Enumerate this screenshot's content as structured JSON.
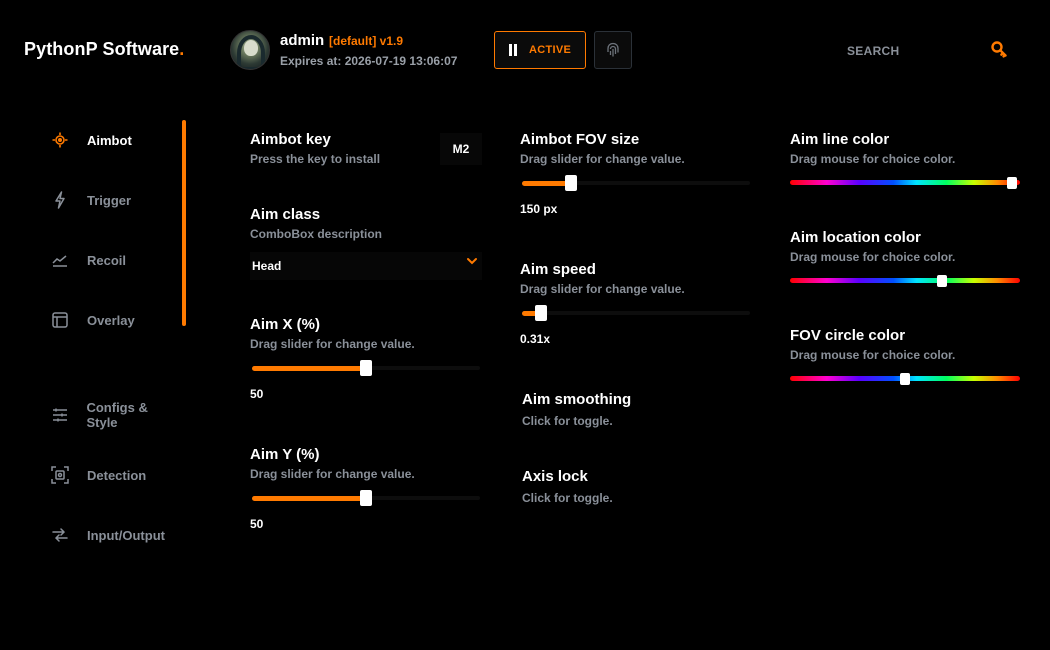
{
  "header": {
    "brand": "PythonP Software",
    "brand_dot": ".",
    "user": {
      "name": "admin",
      "tag": "[default] v1.9",
      "expires": "Expires at: 2026-07-19 13:06:07"
    },
    "status_label": "ACTIVE",
    "search_label": "SEARCH"
  },
  "sidebar": {
    "items": [
      {
        "label": "Aimbot",
        "icon": "crosshair-icon",
        "active": true
      },
      {
        "label": "Trigger",
        "icon": "lightning-icon"
      },
      {
        "label": "Recoil",
        "icon": "chart-line-icon"
      },
      {
        "label": "Overlay",
        "icon": "layout-icon"
      },
      {
        "label": "Configs & Style",
        "icon": "sliders-icon"
      },
      {
        "label": "Detection",
        "icon": "scan-icon"
      },
      {
        "label": "Input/Output",
        "icon": "swap-arrows-icon"
      }
    ]
  },
  "col1": {
    "aimbot_key": {
      "title": "Aimbot key",
      "desc": "Press the key to install",
      "key": "M2"
    },
    "aim_class": {
      "title": "Aim class",
      "desc": "ComboBox description",
      "value": "Head"
    },
    "aim_x": {
      "title": "Aim X (%)",
      "desc": "Drag slider for change value.",
      "value": "50",
      "fraction": 0.5
    },
    "aim_y": {
      "title": "Aim Y (%)",
      "desc": "Drag slider for change value.",
      "value": "50",
      "fraction": 0.5
    }
  },
  "col2": {
    "fov_size": {
      "title": "Aimbot FOV size",
      "desc": "Drag slider for change value.",
      "value": "150 px",
      "fraction": 0.2
    },
    "aim_speed": {
      "title": "Aim speed",
      "desc": "Drag slider for change value.",
      "value": "0.31x",
      "fraction": 0.06
    },
    "smoothing": {
      "title": "Aim smoothing",
      "desc": "Click for toggle."
    },
    "axis_lock": {
      "title": "Axis lock",
      "desc": "Click for toggle."
    }
  },
  "col3": {
    "line_color": {
      "title": "Aim line color",
      "desc": "Drag mouse for choice color.",
      "fraction": 0.985
    },
    "location_color": {
      "title": "Aim location color",
      "desc": "Drag mouse for choice color.",
      "fraction": 0.67
    },
    "fov_color": {
      "title": "FOV circle color",
      "desc": "Drag mouse for choice color.",
      "fraction": 0.5
    }
  },
  "colors": {
    "accent": "#ff7a00",
    "muted": "#8a9099",
    "background": "#000000"
  }
}
